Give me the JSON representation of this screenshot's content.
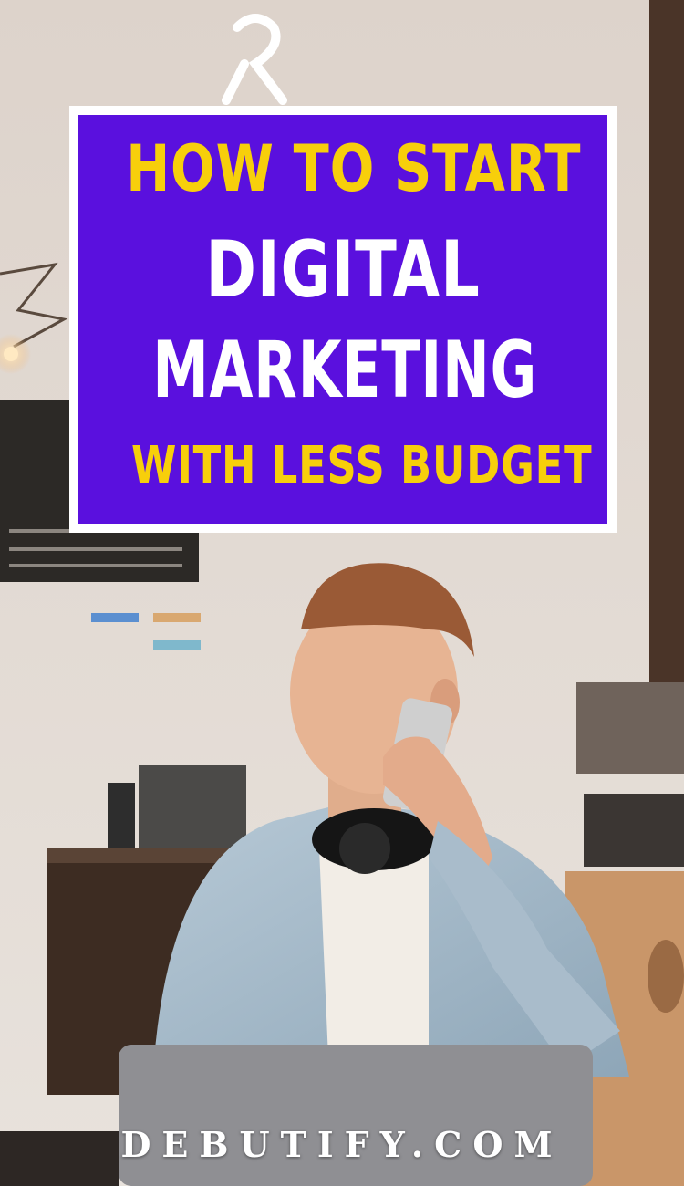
{
  "title": {
    "line1": "HOW TO START",
    "line2": "DIGITAL",
    "line3": "MARKETING",
    "line4": "WITH LESS BUDGET"
  },
  "footer": "DEBUTIFY.COM",
  "colors": {
    "panel": "#5a10de",
    "accent_yellow": "#f7cf0b",
    "text_white": "#ffffff"
  }
}
